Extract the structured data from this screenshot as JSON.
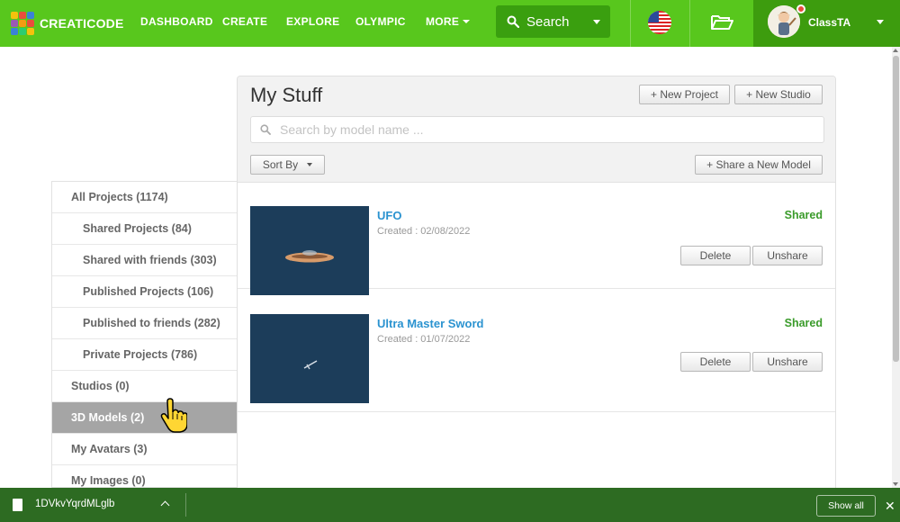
{
  "nav": {
    "logo_text": "CREATICODE",
    "links": [
      "DASHBOARD",
      "CREATE",
      "EXPLORE",
      "OLYMPIC",
      "MORE"
    ],
    "search_label": "Search",
    "user_name": "ClassTA",
    "accent": "#58c71d",
    "accent_dark": "#3d9c0e"
  },
  "sidebar": {
    "items": [
      {
        "label": "All Projects (1174)"
      },
      {
        "label": "Shared Projects (84)"
      },
      {
        "label": "Shared with friends (303)"
      },
      {
        "label": "Published Projects (106)"
      },
      {
        "label": "Published to friends (282)"
      },
      {
        "label": "Private Projects (786)"
      },
      {
        "label": "Studios (0)"
      },
      {
        "label": "3D Models (2)"
      },
      {
        "label": "My Avatars (3)"
      },
      {
        "label": "My Images (0)"
      }
    ],
    "active_index": 7
  },
  "main": {
    "title": "My Stuff",
    "new_project_label": "+ New Project",
    "new_studio_label": "+ New Studio",
    "search_placeholder": "Search by model name ...",
    "sort_label": "Sort By",
    "share_label": "+ Share a New Model",
    "models": [
      {
        "name": "UFO",
        "created": "Created : 02/08/2022",
        "status": "Shared",
        "delete_label": "Delete",
        "unshare_label": "Unshare"
      },
      {
        "name": "Ultra Master Sword",
        "created": "Created : 01/07/2022",
        "status": "Shared",
        "delete_label": "Delete",
        "unshare_label": "Unshare"
      }
    ]
  },
  "downloads": {
    "file_name": "1DVkvYqrdMLglb",
    "show_all_label": "Show all",
    "close_glyph": "✕"
  }
}
